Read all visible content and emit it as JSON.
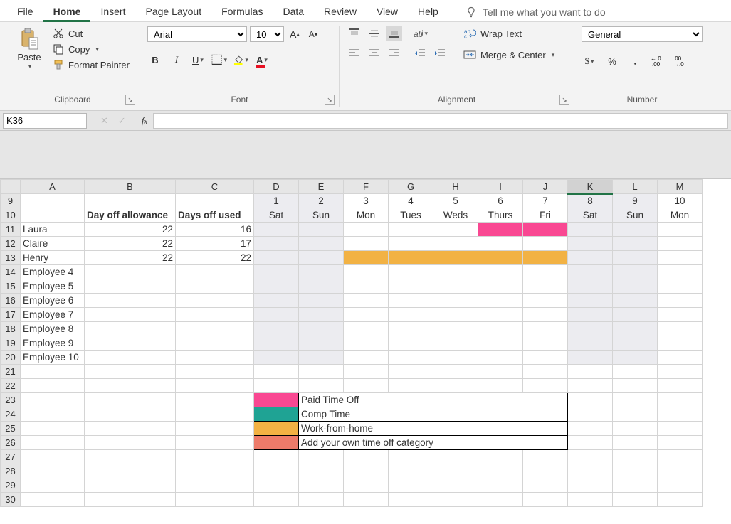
{
  "menu": {
    "tabs": [
      "File",
      "Home",
      "Insert",
      "Page Layout",
      "Formulas",
      "Data",
      "Review",
      "View",
      "Help"
    ],
    "active": "Home",
    "tell_me": "Tell me what you want to do"
  },
  "ribbon": {
    "clipboard": {
      "paste": "Paste",
      "cut": "Cut",
      "copy": "Copy",
      "format_painter": "Format Painter",
      "label": "Clipboard"
    },
    "font": {
      "name": "Arial",
      "size": "10",
      "label": "Font"
    },
    "alignment": {
      "wrap": "Wrap Text",
      "merge": "Merge & Center",
      "label": "Alignment"
    },
    "number": {
      "format": "General",
      "label": "Number"
    }
  },
  "formula_bar": {
    "cell_ref": "K36"
  },
  "columns": [
    "A",
    "B",
    "C",
    "D",
    "E",
    "F",
    "G",
    "H",
    "I",
    "J",
    "K",
    "L",
    "M"
  ],
  "row_start": 9,
  "row_end": 30,
  "active_col": "K",
  "headers": {
    "b": "Day off allowance",
    "c": "Days off used"
  },
  "day_numbers": [
    "1",
    "2",
    "3",
    "4",
    "5",
    "6",
    "7",
    "8",
    "9",
    "10"
  ],
  "day_names": [
    "Sat",
    "Sun",
    "Mon",
    "Tues",
    "Weds",
    "Thurs",
    "Fri",
    "Sat",
    "Sun",
    "Mon"
  ],
  "employees": [
    {
      "name": "Laura",
      "allow": "22",
      "used": "16"
    },
    {
      "name": "Claire",
      "allow": "22",
      "used": "17"
    },
    {
      "name": "Henry",
      "allow": "22",
      "used": "22"
    },
    {
      "name": "Employee 4",
      "allow": "",
      "used": ""
    },
    {
      "name": "Employee 5",
      "allow": "",
      "used": ""
    },
    {
      "name": "Employee 6",
      "allow": "",
      "used": ""
    },
    {
      "name": "Employee 7",
      "allow": "",
      "used": ""
    },
    {
      "name": "Employee 8",
      "allow": "",
      "used": ""
    },
    {
      "name": "Employee 9",
      "allow": "",
      "used": ""
    },
    {
      "name": "Employee 10",
      "allow": "",
      "used": ""
    }
  ],
  "legend": [
    {
      "color": "pink",
      "label": "Paid Time Off"
    },
    {
      "color": "teal",
      "label": "Comp Time"
    },
    {
      "color": "orange",
      "label": "Work-from-home"
    },
    {
      "color": "salmon",
      "label": "Add your own time off category"
    }
  ],
  "weekend_cols_idx": [
    3,
    4,
    10,
    11
  ],
  "highlights": {
    "11": {
      "8": "pink",
      "9": "pink"
    },
    "13": {
      "5": "orange",
      "6": "orange",
      "7": "orange",
      "8": "orange",
      "9": "orange"
    }
  }
}
